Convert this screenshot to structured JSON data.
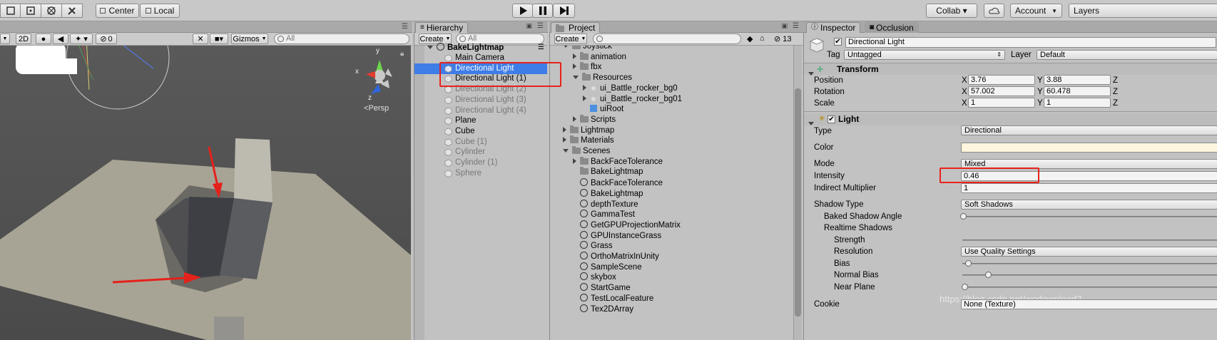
{
  "toolbar": {
    "pivot": "Center",
    "space": "Local",
    "collab": "Collab ▾",
    "account": "Account",
    "layers": "Layers"
  },
  "scene": {
    "mode_2d": "2D",
    "gizmos": "Gizmos",
    "search_placeholder": "All",
    "hidden_count": "0",
    "persp_label": "Persp",
    "axis_y": "y",
    "axis_x": "x",
    "axis_z": "z"
  },
  "hierarchy": {
    "tab": "Hierarchy",
    "create": "Create",
    "search_placeholder": "All",
    "scene_name": "BakeLightmap",
    "items": [
      {
        "label": "Main Camera",
        "disabled": false,
        "selected": false
      },
      {
        "label": "Directional Light",
        "disabled": false,
        "selected": true
      },
      {
        "label": "Directional Light (1)",
        "disabled": false,
        "selected": false
      },
      {
        "label": "Directional Light (2)",
        "disabled": true,
        "selected": false
      },
      {
        "label": "Directional Light (3)",
        "disabled": true,
        "selected": false
      },
      {
        "label": "Directional Light (4)",
        "disabled": true,
        "selected": false
      },
      {
        "label": "Plane",
        "disabled": false,
        "selected": false
      },
      {
        "label": "Cube",
        "disabled": false,
        "selected": false
      },
      {
        "label": "Cube (1)",
        "disabled": true,
        "selected": false
      },
      {
        "label": "Cylinder",
        "disabled": true,
        "selected": false
      },
      {
        "label": "Cylinder (1)",
        "disabled": true,
        "selected": false
      },
      {
        "label": "Sphere",
        "disabled": true,
        "selected": false
      }
    ]
  },
  "project": {
    "tab": "Project",
    "create": "Create",
    "asset_count": "13",
    "items": [
      {
        "label": "Joystick",
        "kind": "folder",
        "depth": 0,
        "arrow": "open"
      },
      {
        "label": "animation",
        "kind": "folder",
        "depth": 1,
        "arrow": "closed"
      },
      {
        "label": "fbx",
        "kind": "folder",
        "depth": 1,
        "arrow": "closed"
      },
      {
        "label": "Resources",
        "kind": "folder",
        "depth": 1,
        "arrow": "open"
      },
      {
        "label": "ui_Battle_rocker_bg0",
        "kind": "asset",
        "depth": 2,
        "arrow": "closed"
      },
      {
        "label": "ui_Battle_rocker_bg01",
        "kind": "asset",
        "depth": 2,
        "arrow": "closed"
      },
      {
        "label": "uiRoot",
        "kind": "prefab",
        "depth": 2,
        "arrow": "none"
      },
      {
        "label": "Scripts",
        "kind": "folder",
        "depth": 1,
        "arrow": "closed"
      },
      {
        "label": "Lightmap",
        "kind": "folder",
        "depth": 0,
        "arrow": "closed"
      },
      {
        "label": "Materials",
        "kind": "folder",
        "depth": 0,
        "arrow": "closed"
      },
      {
        "label": "Scenes",
        "kind": "folder",
        "depth": 0,
        "arrow": "open"
      },
      {
        "label": "BackFaceTolerance",
        "kind": "folder",
        "depth": 1,
        "arrow": "closed"
      },
      {
        "label": "BakeLightmap",
        "kind": "folder",
        "depth": 1,
        "arrow": "none"
      },
      {
        "label": "BackFaceTolerance",
        "kind": "scene",
        "depth": 1,
        "arrow": "none"
      },
      {
        "label": "BakeLightmap",
        "kind": "scene",
        "depth": 1,
        "arrow": "none"
      },
      {
        "label": "depthTexture",
        "kind": "scene",
        "depth": 1,
        "arrow": "none"
      },
      {
        "label": "GammaTest",
        "kind": "scene",
        "depth": 1,
        "arrow": "none"
      },
      {
        "label": "GetGPUProjectionMatrix",
        "kind": "scene",
        "depth": 1,
        "arrow": "none"
      },
      {
        "label": "GPUInstanceGrass",
        "kind": "scene",
        "depth": 1,
        "arrow": "none"
      },
      {
        "label": "Grass",
        "kind": "scene",
        "depth": 1,
        "arrow": "none"
      },
      {
        "label": "OrthoMatrixInUnity",
        "kind": "scene",
        "depth": 1,
        "arrow": "none"
      },
      {
        "label": "SampleScene",
        "kind": "scene",
        "depth": 1,
        "arrow": "none"
      },
      {
        "label": "skybox",
        "kind": "scene",
        "depth": 1,
        "arrow": "none"
      },
      {
        "label": "StartGame",
        "kind": "scene",
        "depth": 1,
        "arrow": "none"
      },
      {
        "label": "TestLocalFeature",
        "kind": "scene",
        "depth": 1,
        "arrow": "none"
      },
      {
        "label": "Tex2DArray",
        "kind": "scene",
        "depth": 1,
        "arrow": "none"
      }
    ]
  },
  "inspector": {
    "tab": "Inspector",
    "tab2": "Occlusion",
    "object_name": "Directional Light",
    "tag_label": "Tag",
    "tag_value": "Untagged",
    "layer_label": "Layer",
    "layer_value": "Default",
    "transform": {
      "title": "Transform",
      "position_label": "Position",
      "px": "3.76",
      "py": "3.88",
      "rotation_label": "Rotation",
      "rx": "57.002",
      "ry": "60.478",
      "scale_label": "Scale",
      "sx": "1",
      "sy": "1",
      "x": "X",
      "y": "Y",
      "z": "Z"
    },
    "light": {
      "title": "Light",
      "type_label": "Type",
      "type_value": "Directional",
      "color_label": "Color",
      "color_value": "#fff6de",
      "mode_label": "Mode",
      "mode_value": "Mixed",
      "intensity_label": "Intensity",
      "intensity_value": "0.46",
      "indirect_label": "Indirect Multiplier",
      "indirect_value": "1",
      "shadow_type_label": "Shadow Type",
      "shadow_type_value": "Soft Shadows",
      "baked_angle_label": "Baked Shadow Angle",
      "realtime_label": "Realtime Shadows",
      "strength_label": "Strength",
      "resolution_label": "Resolution",
      "resolution_value": "Use Quality Settings",
      "bias_label": "Bias",
      "normal_bias_label": "Normal Bias",
      "near_plane_label": "Near Plane",
      "cookie_label": "Cookie",
      "cookie_value": "None (Texture)"
    }
  },
  "watermark": "https://blog.csdn.net/wodownload2"
}
